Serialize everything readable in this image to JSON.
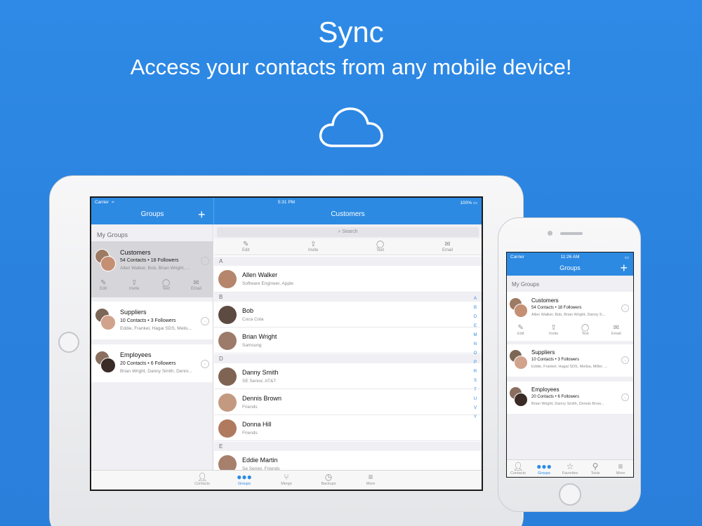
{
  "hero": {
    "title": "Sync",
    "subtitle": "Access your contacts from any mobile device!",
    "icon": "cloud-icon"
  },
  "colors": {
    "background": "#2b84df",
    "accent": "#2c8ae2",
    "white": "#ffffff"
  },
  "ipad": {
    "status": {
      "carrier": "Carrier",
      "time": "5:31 PM",
      "battery": "100%"
    },
    "left_nav_title": "Groups",
    "right_nav_title": "Customers",
    "section_header": "My Groups",
    "groups": [
      {
        "name": "Customers",
        "meta": "54 Contacts • 18 Followers",
        "members": "Allen Walker, Bob, Brian Wright, ..."
      },
      {
        "name": "Suppliers",
        "meta": "10 Contacts • 3 Followers",
        "members": "Eddie, Frankel, Hagai SDS, Melis..."
      },
      {
        "name": "Employees",
        "meta": "20 Contacts • 6 Followers",
        "members": "Brian Wright, Danny Smith, Denni..."
      }
    ],
    "group_actions": [
      "Edit",
      "Invite",
      "Text",
      "Email"
    ],
    "search_placeholder": "Search",
    "toolbar": [
      "Edit",
      "Invite",
      "Text",
      "Email"
    ],
    "contacts": [
      {
        "letter": "A"
      },
      {
        "name": "Allen Walker",
        "sub": "Software Engineer, Apple"
      },
      {
        "letter": "B"
      },
      {
        "name": "Bob",
        "sub": "Coca Cola"
      },
      {
        "name": "Brian Wright",
        "sub": "Samsung"
      },
      {
        "letter": "D"
      },
      {
        "name": "Danny Smith",
        "sub": "SE Senior, AT&T"
      },
      {
        "name": "Dennis Brown",
        "sub": "Friends"
      },
      {
        "name": "Donna Hill",
        "sub": "Friends"
      },
      {
        "letter": "E"
      },
      {
        "name": "Eddie Martin",
        "sub": "Se Senior, Friends"
      }
    ],
    "index_letters": [
      "A",
      "B",
      "D",
      "E",
      "M",
      "N",
      "O",
      "P",
      "R",
      "S",
      "T",
      "U",
      "V",
      "Y"
    ],
    "tabs": [
      "Contacts",
      "Groups",
      "Merge",
      "Backups",
      "More"
    ]
  },
  "iphone": {
    "status": {
      "carrier": "Carrier",
      "time": "11:26 AM"
    },
    "nav_title": "Groups",
    "section_header": "My Groups",
    "groups": [
      {
        "name": "Customers",
        "meta": "54 Contacts • 18 Followers",
        "members": "Allen Walker, Bob, Brian Wright, Danny S..."
      },
      {
        "name": "Suppliers",
        "meta": "10 Contacts • 3 Followers",
        "members": "Eddie, Frankel, Hagai SDS, Melisa, Miller, ..."
      },
      {
        "name": "Employees",
        "meta": "20 Contacts • 6 Followers",
        "members": "Brian Wright, Danny Smith, Dennis Brow..."
      }
    ],
    "group_actions": [
      "Edit",
      "Invite",
      "Text",
      "Email"
    ],
    "tabs": [
      "Contacts",
      "Groups",
      "Favorites",
      "Tools",
      "More"
    ]
  }
}
